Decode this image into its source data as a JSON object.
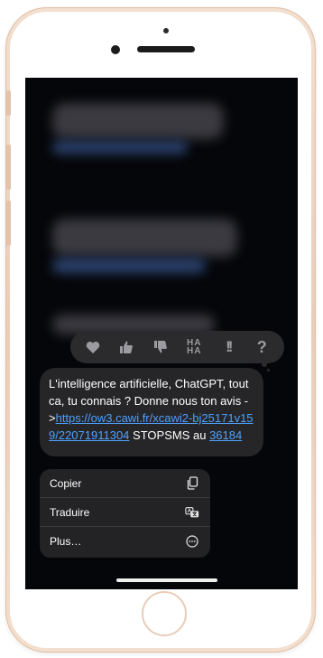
{
  "message": {
    "text_before_link": "L'intelligence artificielle, ChatGPT, tout ca, tu connais ? Donne nous ton avis ->",
    "link_text": "https://ow3.cawi.fr/xcawi2-bj25171v159/22071911304",
    "text_after_link": " STOPSMS au ",
    "stop_number": "36184"
  },
  "reactions": [
    {
      "name": "heart-icon"
    },
    {
      "name": "thumbs-up-icon"
    },
    {
      "name": "thumbs-down-icon"
    },
    {
      "name": "haha-icon",
      "label": "HA HA"
    },
    {
      "name": "exclamation-icon",
      "label": "!!"
    },
    {
      "name": "question-icon",
      "label": "?"
    }
  ],
  "context_menu": {
    "items": [
      {
        "label": "Copier",
        "icon": "copy-icon"
      },
      {
        "label": "Traduire",
        "icon": "translate-icon"
      },
      {
        "label": "Plus…",
        "icon": "more-icon"
      }
    ]
  },
  "colors": {
    "screen_background": "#05060a",
    "bubble_background": "#262628",
    "link": "#4ea1ff",
    "phone_frame": "#e9cdb8"
  }
}
